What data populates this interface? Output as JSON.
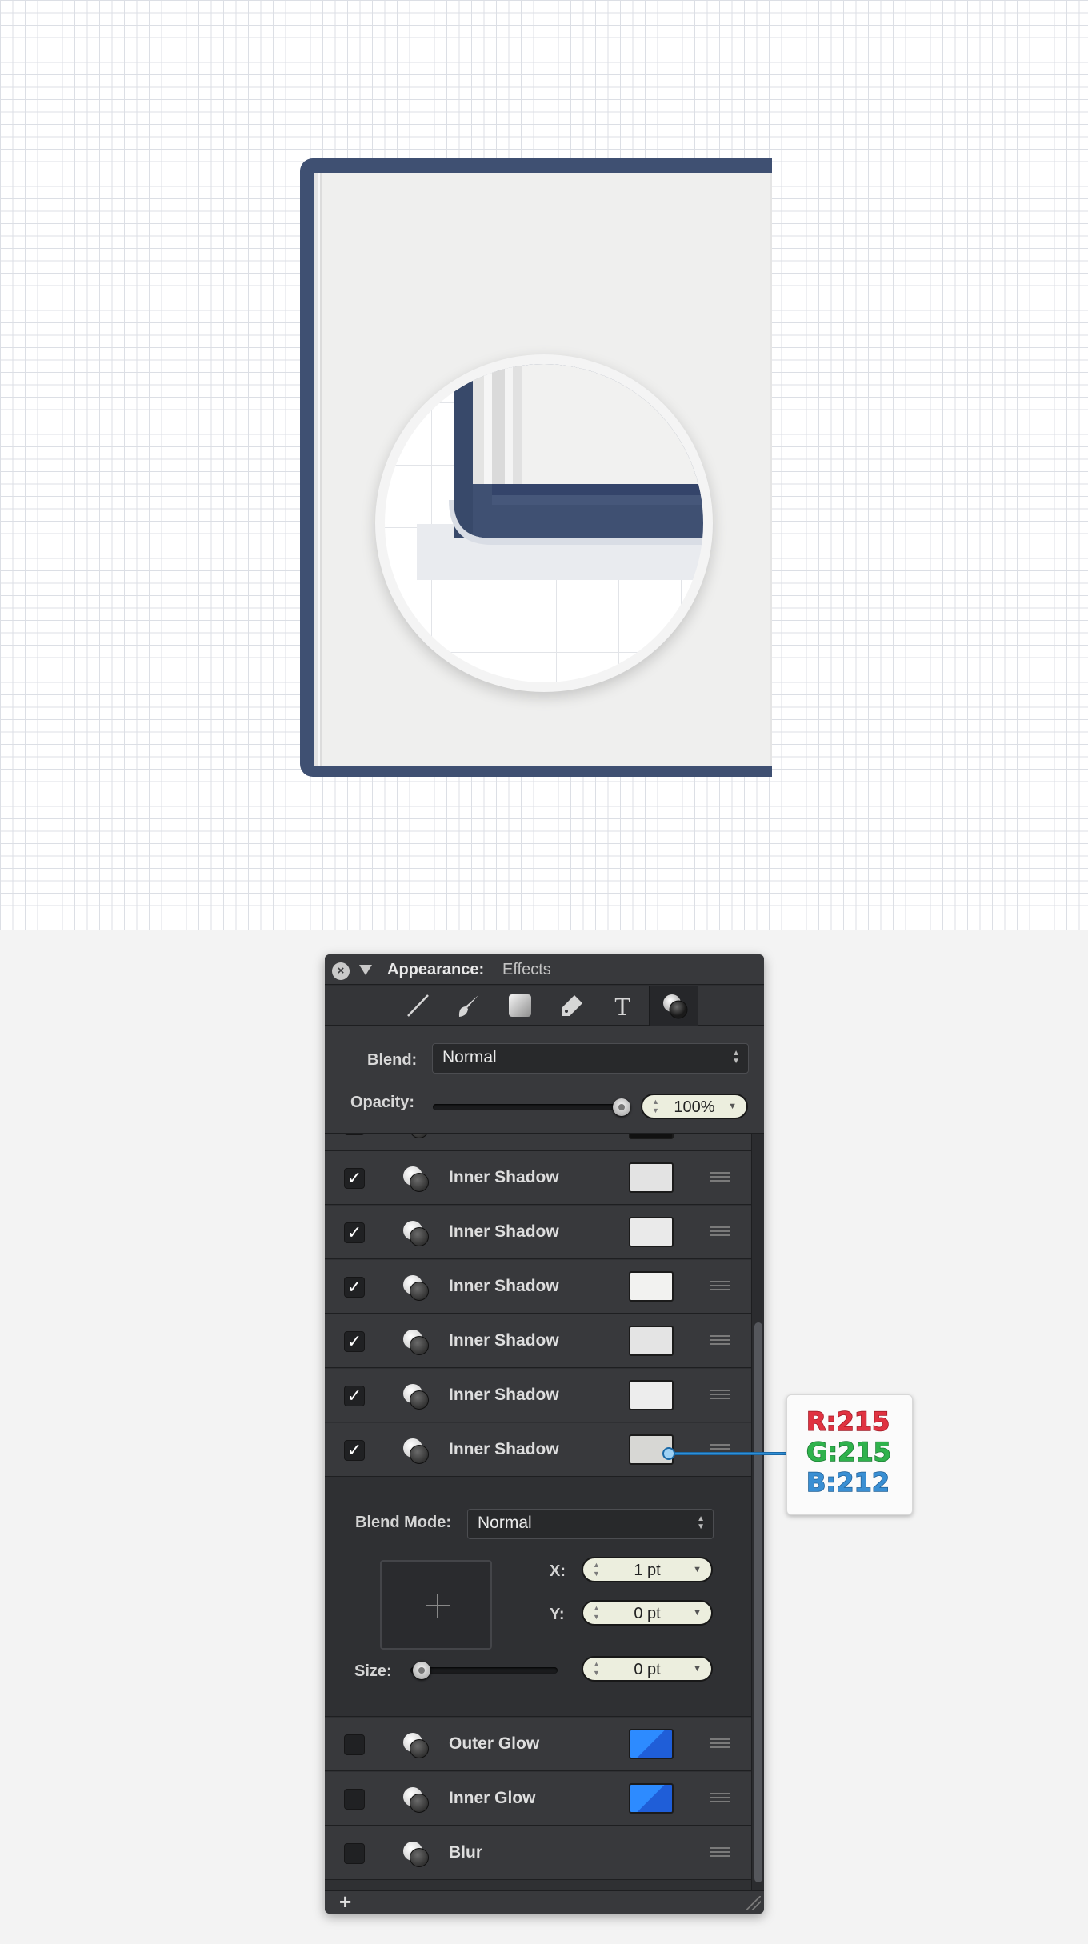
{
  "colors": {
    "book_blue": "#3f5072",
    "page_fill": "#efefee",
    "panel_bg": "#2d2e31",
    "field_bg": "#eceede",
    "glow_blue": "#2d8bff",
    "callout_red": "#e03341",
    "callout_green": "#2fb24c",
    "callout_blue": "#3a8fd3"
  },
  "panel": {
    "title": "Appearance:",
    "subtitle": "Effects",
    "close_icon": "close-x-icon",
    "tools": [
      {
        "name": "stroke-line-icon"
      },
      {
        "name": "brush-icon"
      },
      {
        "name": "fill-square-icon"
      },
      {
        "name": "eraser-icon"
      },
      {
        "name": "text-icon",
        "glyph": "T"
      },
      {
        "name": "effects-icon",
        "active": true
      }
    ],
    "blend_label": "Blend:",
    "blend_value": "Normal",
    "opacity_label": "Opacity:",
    "opacity_value": "100%",
    "opacity_fraction": 1.0,
    "effects": [
      {
        "label": "Inner Shadow",
        "checked": true,
        "swatch": "#e3e3e3"
      },
      {
        "label": "Inner Shadow",
        "checked": true,
        "swatch": "#eaeaea"
      },
      {
        "label": "Inner Shadow",
        "checked": true,
        "swatch": "#f2f2f0"
      },
      {
        "label": "Inner Shadow",
        "checked": true,
        "swatch": "#e4e4e4"
      },
      {
        "label": "Inner Shadow",
        "checked": true,
        "swatch": "#ededed"
      },
      {
        "label": "Inner Shadow",
        "checked": true,
        "swatch": "#d7d7d4"
      }
    ],
    "detail": {
      "blend_mode_label": "Blend Mode:",
      "blend_mode_value": "Normal",
      "x_label": "X:",
      "x_value": "1 pt",
      "y_label": "Y:",
      "y_value": "0 pt",
      "size_label": "Size:",
      "size_value": "0 pt",
      "size_fraction": 0.0
    },
    "bottom_effects": [
      {
        "label": "Outer Glow",
        "checked": false
      },
      {
        "label": "Inner Glow",
        "checked": false
      },
      {
        "label": "Blur",
        "checked": false
      }
    ],
    "add_label": "+"
  },
  "callout": {
    "r": "R:215",
    "g": "G:215",
    "b": "B:212"
  }
}
